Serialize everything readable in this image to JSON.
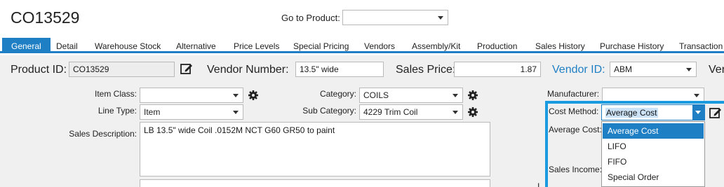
{
  "header": {
    "title": "CO13529",
    "goto_label": "Go to Product:",
    "goto_value": ""
  },
  "tabs": [
    {
      "label": "General"
    },
    {
      "label": "Detail"
    },
    {
      "label": "Warehouse Stock"
    },
    {
      "label": "Alternative"
    },
    {
      "label": "Price Levels"
    },
    {
      "label": "Special Pricing"
    },
    {
      "label": "Vendors"
    },
    {
      "label": "Assembly/Kit"
    },
    {
      "label": "Production"
    },
    {
      "label": "Sales History"
    },
    {
      "label": "Purchase History"
    },
    {
      "label": "Transaction"
    }
  ],
  "top_row": {
    "product_id_label": "Product ID:",
    "product_id_value": "CO13529",
    "vendor_number_label": "Vendor Number:",
    "vendor_number_value": "13.5\" wide",
    "sales_price_label": "Sales Price:",
    "sales_price_value": "1.87",
    "vendor_id_label": "Vendor ID:",
    "vendor_id_value": "ABM",
    "cut_label": "Ver"
  },
  "form": {
    "item_class_label": "Item Class:",
    "item_class_value": "",
    "line_type_label": "Line Type:",
    "line_type_value": "Item",
    "sales_description_label": "Sales Description:",
    "sales_description_value": "LB 13.5\" wide Coil .0152M NCT G60 GR50 to paint",
    "category_label": "Category:",
    "category_value": "COILS",
    "sub_category_label": "Sub Category:",
    "sub_category_value": "4229 Trim Coil",
    "manufacturer_label": "Manufacturer:",
    "manufacturer_value": "",
    "cost_method_label": "Cost Method:",
    "cost_method_value": "Average Cost",
    "average_cost_label": "Average Cost:",
    "sales_income_label": "Sales Income:",
    "cut_label_bottom": "I"
  },
  "cost_method_options": [
    "Average Cost",
    "LIFO",
    "FIFO",
    "Special Order"
  ],
  "colors": {
    "accent": "#1f7fc4",
    "highlight": "#1a9be0"
  }
}
